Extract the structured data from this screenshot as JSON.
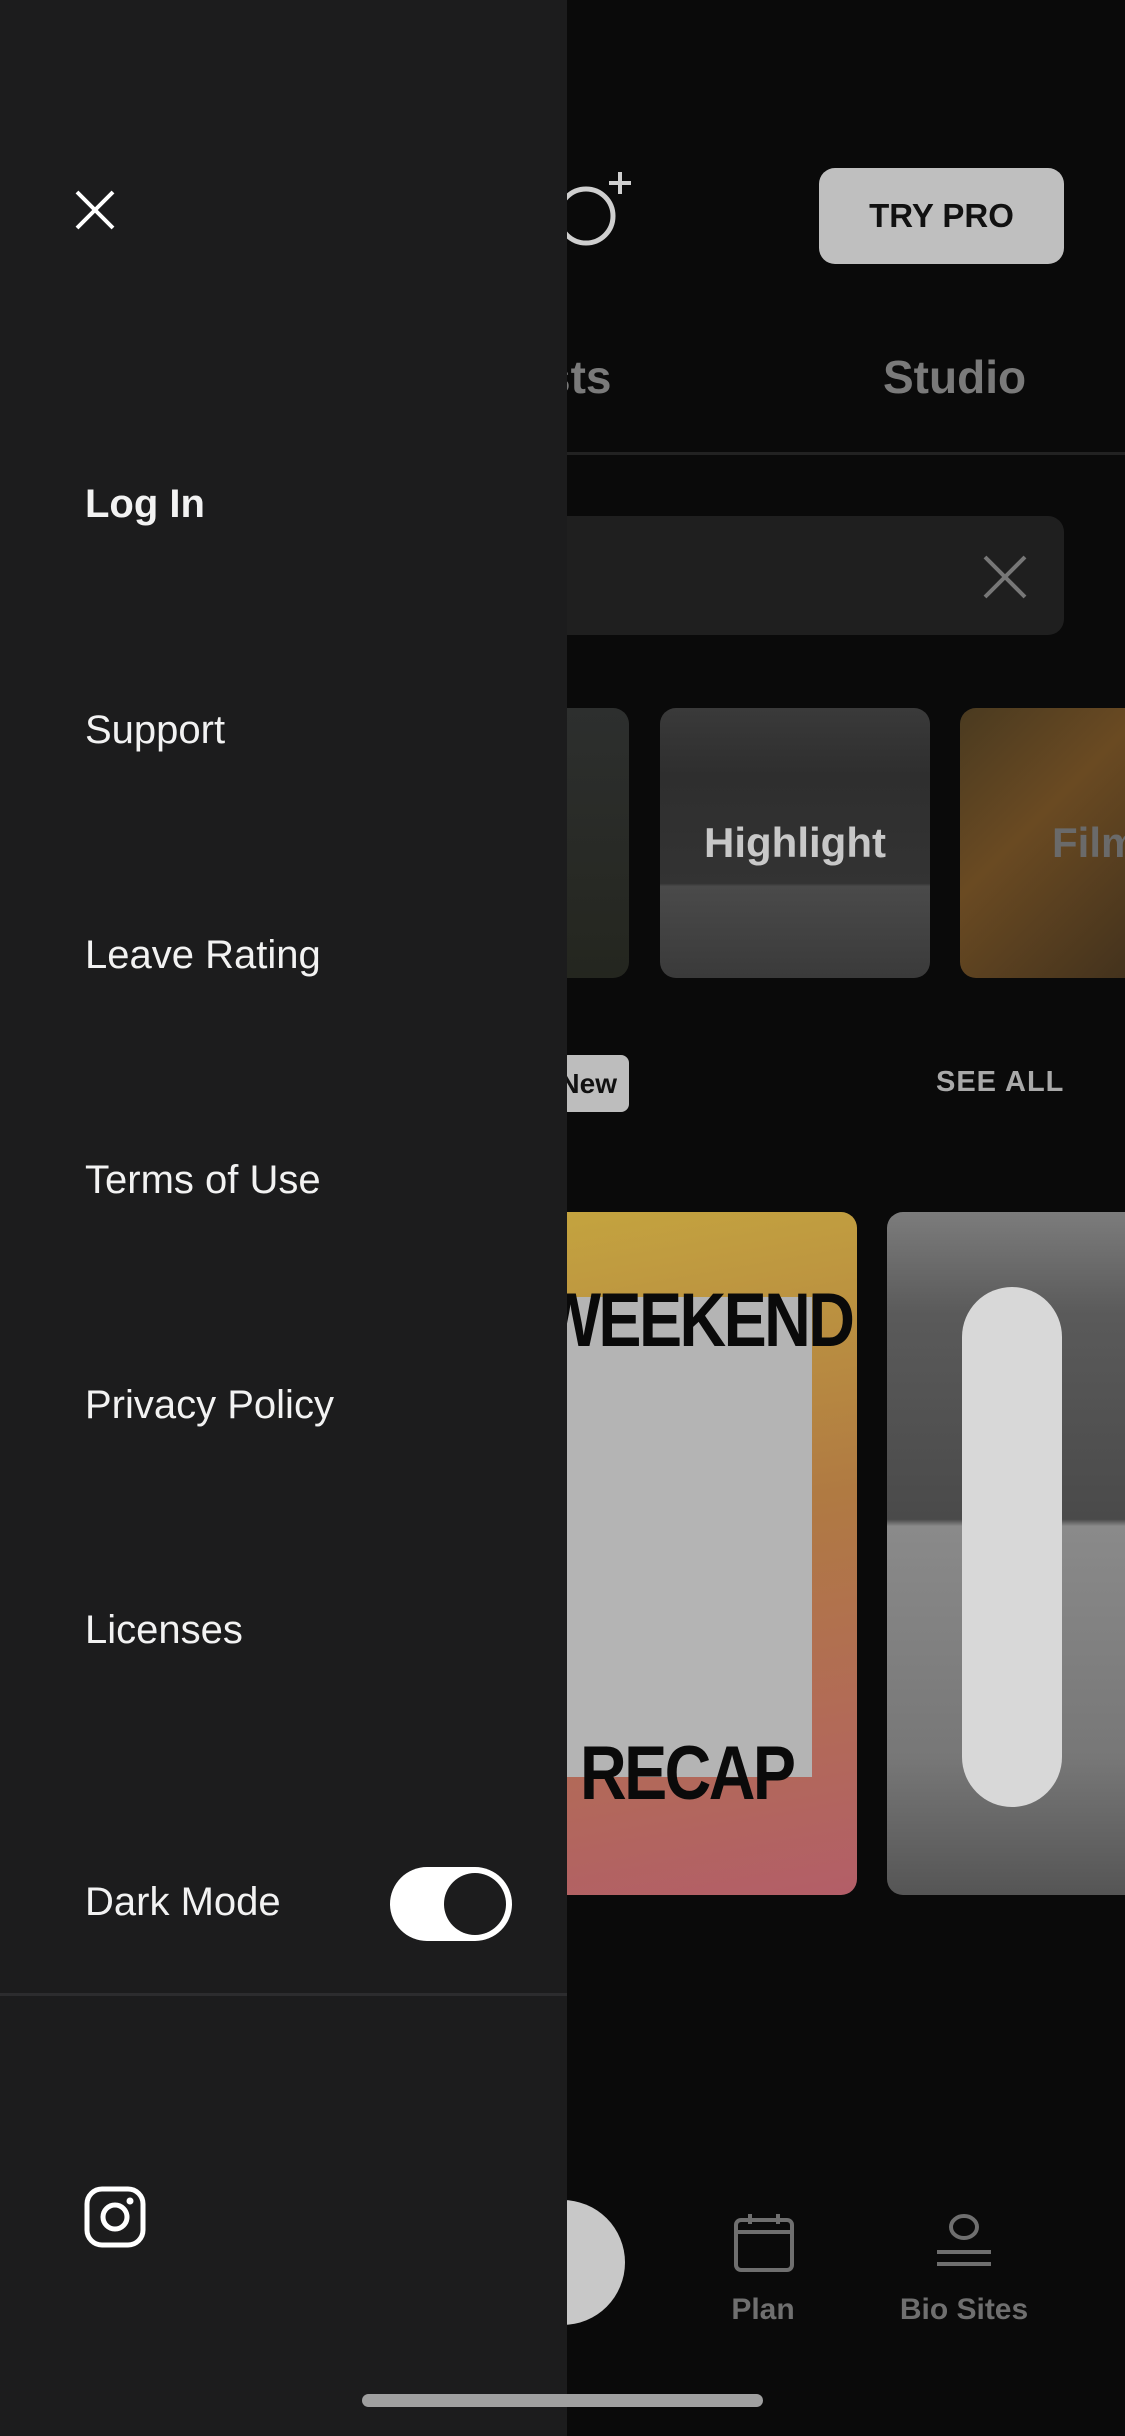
{
  "header": {
    "try_pro_label": "TRY PRO"
  },
  "tabs": [
    {
      "label": "sts"
    },
    {
      "label": "Studio"
    }
  ],
  "templates": [
    {
      "label": ""
    },
    {
      "label": "Highlight"
    },
    {
      "label": "Film"
    }
  ],
  "section": {
    "badge": "New",
    "see_all": "SEE ALL"
  },
  "featured": [
    {
      "title_top": "WEEKEND",
      "title_bottom": "RECAP"
    },
    {
      "title_top": ""
    }
  ],
  "bottom_nav": [
    {
      "label": "Plan",
      "icon": "calendar-icon"
    },
    {
      "label": "Bio Sites",
      "icon": "bio-sites-icon"
    }
  ],
  "drawer": {
    "items": [
      {
        "label": "Log In"
      },
      {
        "label": "Support"
      },
      {
        "label": "Leave Rating"
      },
      {
        "label": "Terms of Use"
      },
      {
        "label": "Privacy Policy"
      },
      {
        "label": "Licenses"
      }
    ],
    "dark_mode": {
      "label": "Dark Mode",
      "enabled": true
    }
  },
  "colors": {
    "drawer_bg": "#1c1c1d",
    "background": "#0a0a0a",
    "toggle_on": "#ffffff"
  }
}
